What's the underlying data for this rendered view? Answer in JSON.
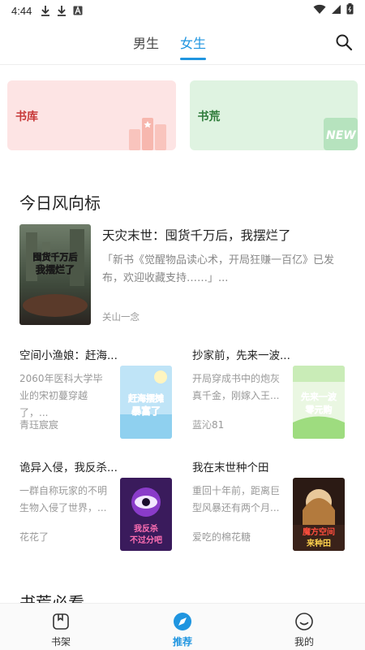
{
  "status_bar": {
    "time": "4:44",
    "icons": [
      "download-icon",
      "download-icon",
      "text-a-icon",
      "wifi-icon",
      "signal-icon",
      "battery-icon"
    ]
  },
  "header": {
    "tabs": [
      {
        "label": "男生",
        "active": false
      },
      {
        "label": "女生",
        "active": true
      }
    ],
    "accent_color": "#1f95e0"
  },
  "categories": {
    "library": {
      "label": "书库",
      "color": "#fde4e4"
    },
    "shortage": {
      "label": "书荒",
      "color": "#dff3e1",
      "badge": "NEW"
    }
  },
  "trend_section": {
    "title": "今日风向标",
    "featured": {
      "title": "天灾末世：囤货千万后，我摆烂了",
      "desc": "「新书《觉醒物品读心术，开局狂赚一百亿》已发布，欢迎收藏支持……」...",
      "author": "关山一念",
      "cover_text": "囤货千万后 我摆烂了"
    },
    "books": [
      {
        "title": "空间小渔娘：赶海...",
        "desc": "2060年医科大学毕业的宋初蔓穿越了，...",
        "author": "青珏宸宸",
        "cover_text": "赶海摆摊暴富了"
      },
      {
        "title": "抄家前，先来一波...",
        "desc": "开局穿成书中的炮灰真千金，刚嫁入王...",
        "author": "蓝沁81",
        "cover_text": "先来一波零元购"
      },
      {
        "title": "诡异入侵，我反杀...",
        "desc": "一群自称玩家的不明生物入侵了世界，...",
        "author": "花花了",
        "cover_text": "我反杀不过分吧"
      },
      {
        "title": "我在末世种个田",
        "desc": "重回十年前，距离巨型风暴还有两个月...",
        "author": "爱吃的棉花糖",
        "cover_text": "魔方空间来种田"
      }
    ]
  },
  "must_section": {
    "title": "书荒必看"
  },
  "bottom_nav": [
    {
      "label": "书架",
      "icon": "bookshelf-icon",
      "active": false
    },
    {
      "label": "推荐",
      "icon": "compass-icon",
      "active": true
    },
    {
      "label": "我的",
      "icon": "smile-icon",
      "active": false
    }
  ]
}
